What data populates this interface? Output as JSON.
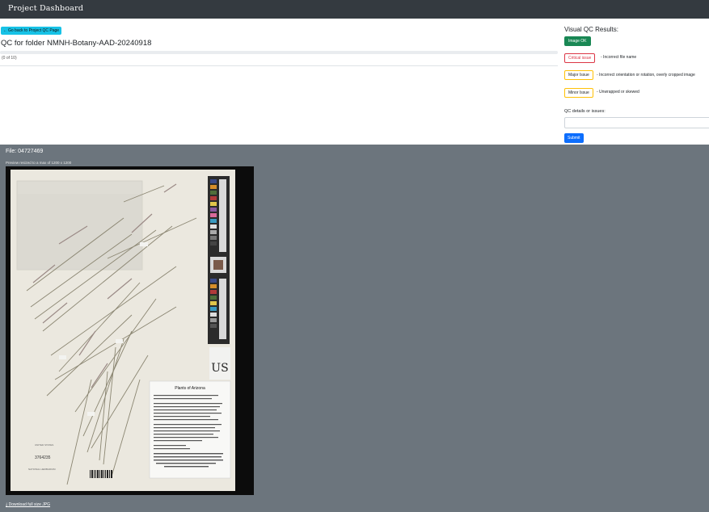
{
  "navbar": {
    "brand": "Project Dashboard"
  },
  "main": {
    "back_button": "Go back to Project QC Page",
    "title": "QC for folder NMNH-Botany-AAD-20240918",
    "progress_text": "(0 of 10)",
    "progress_fraction": 0
  },
  "qc": {
    "title": "Visual QC Results:",
    "ok_label": "Image OK",
    "critical_label": "Critical issue",
    "critical_desc": "- Incorrect file name",
    "major_label": "Major Issue",
    "major_desc": "- Incorrect orientation or rotation, overly cropped image",
    "minor_label": "Minor Issue",
    "minor_desc": "- Unwrapped or skewed",
    "details_label": "QC details or issues:",
    "details_value": "",
    "submit_label": "Submit"
  },
  "viewer": {
    "file_label": "File: 04727469",
    "preview_note": "Preview resized to a max of 1200 x 1200",
    "download_label": "Download full size JPG",
    "specimen": {
      "herbarium_code": "US",
      "label_title": "Plants of Arizona",
      "label_text": "Bouteloua curtipendula (Michx.) Torr. United States, Arizona. Coconino County. Collected under the auspices of the Bureau of Land Management, U.S. Department of the Interior for the Seeds of Success Native Seed Collection Program",
      "barcode_number": "3764235",
      "collection_stamp": "UNITED STATES",
      "museum_stamp": "NATIONAL HERBARIUM"
    }
  },
  "colors": {
    "navbar": "#343a40",
    "back_button": "#17c2e6",
    "ok": "#198754",
    "critical": "#dc3545",
    "warning": "#ffc107",
    "submit": "#0d6efd",
    "viewer_bg": "#6c757d"
  },
  "icons": {
    "back": "arrow-left-icon",
    "download": "download-icon"
  }
}
